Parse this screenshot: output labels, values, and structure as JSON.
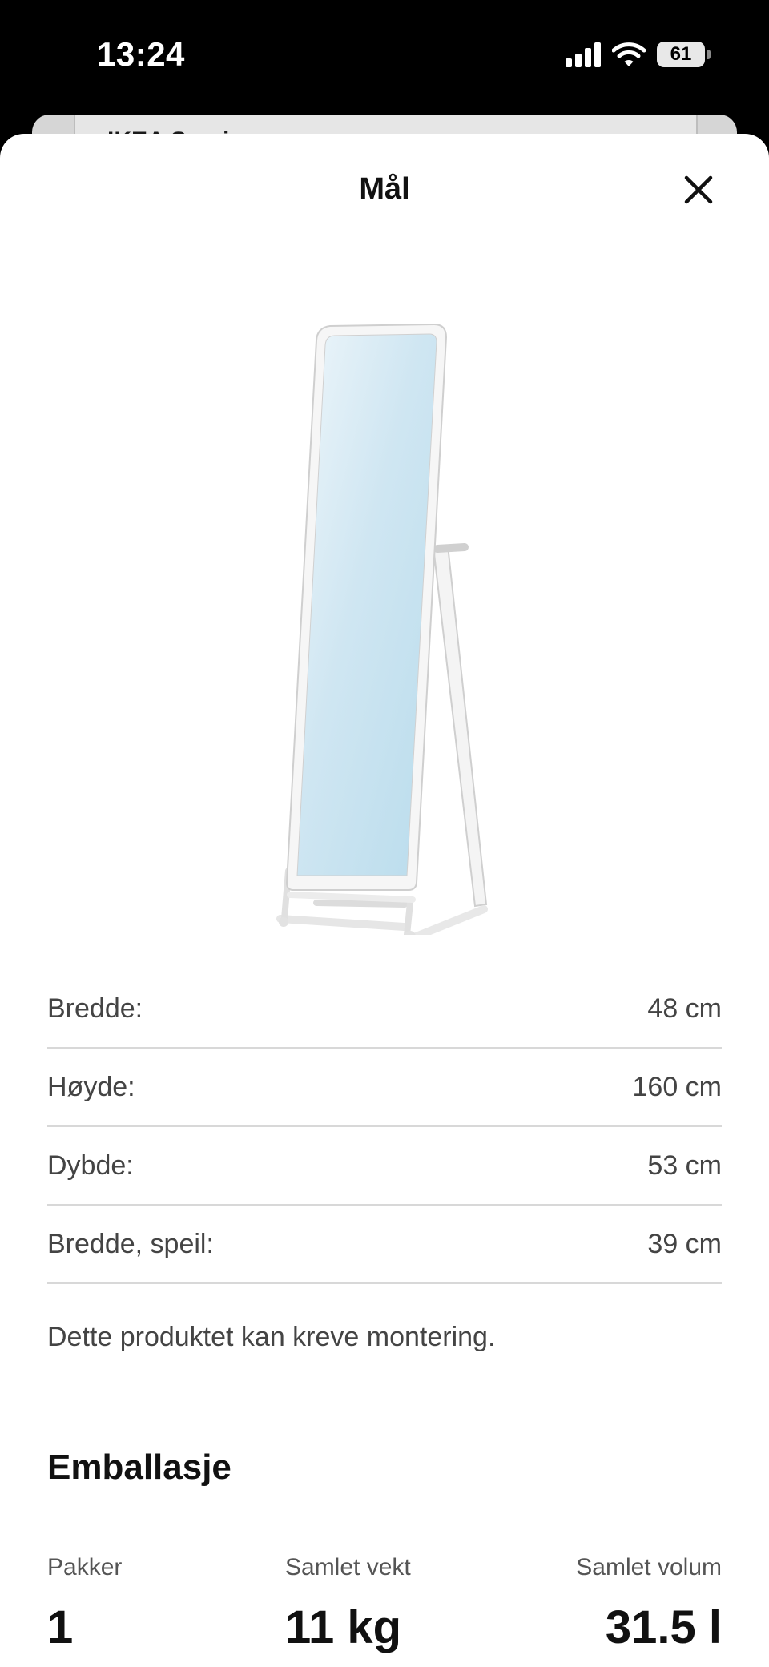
{
  "status_bar": {
    "time": "13:24",
    "battery": "61"
  },
  "background_page": {
    "title": "IKEA Sverige"
  },
  "sheet": {
    "title": "Mål"
  },
  "dimensions": [
    {
      "label": "Bredde:",
      "value": "48 cm"
    },
    {
      "label": "Høyde:",
      "value": "160 cm"
    },
    {
      "label": "Dybde:",
      "value": "53 cm"
    },
    {
      "label": "Bredde, speil:",
      "value": "39 cm"
    }
  ],
  "note": "Dette produktet kan kreve montering.",
  "packaging": {
    "title": "Emballasje",
    "stats": [
      {
        "label": "Pakker",
        "value": "1"
      },
      {
        "label": "Samlet vekt",
        "value": "11 kg"
      },
      {
        "label": "Samlet volum",
        "value": "31.5 l"
      }
    ]
  },
  "colors": {
    "accent": "#111111",
    "divider": "#d8d8d8",
    "mirror": "#d6ebf5"
  },
  "icons": {
    "close": "close-icon",
    "signal": "cellular-signal-icon",
    "wifi": "wifi-icon",
    "battery": "battery-icon"
  }
}
